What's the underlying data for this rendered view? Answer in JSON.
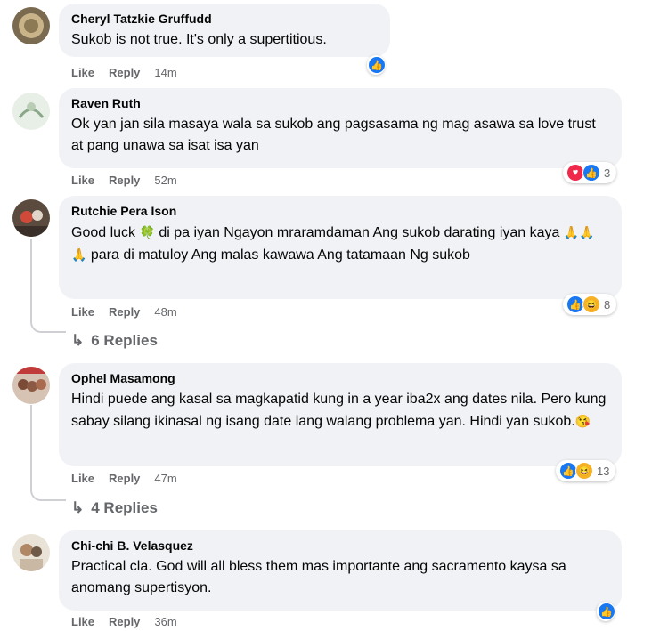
{
  "comments": [
    {
      "author": "Cheryl Tatzkie Gruffudd",
      "text": "Sukob is not true. It's only a supertitious.",
      "like": "Like",
      "reply": "Reply",
      "time": "14m",
      "reaction_count": ""
    },
    {
      "author": "Raven Ruth",
      "text": "Ok yan jan sila masaya wala sa sukob ang pagsasama ng mag asawa sa love trust at pang unawa sa isat isa yan",
      "like": "Like",
      "reply": "Reply",
      "time": "52m",
      "reaction_count": "3"
    },
    {
      "author": "Rutchie Pera Ison",
      "text_a": "Good luck ",
      "emoji_clover": "🍀",
      "text_b": " di pa iyan Ngayon mraramdaman Ang sukob darating iyan kaya ",
      "emoji_pray": "🙏🙏🙏",
      "text_c": " para di matuloy Ang malas kawawa Ang tatamaan Ng sukob",
      "like": "Like",
      "reply": "Reply",
      "time": "48m",
      "reaction_count": "8",
      "replies": "6 Replies"
    },
    {
      "author": "Ophel Masamong",
      "text": "Hindi puede ang kasal sa magkapatid kung in a year iba2x ang dates nila. Pero kung sabay silang ikinasal ng isang date lang walang problema yan. Hindi yan sukob.",
      "emoji_kiss": "😘",
      "like": "Like",
      "reply": "Reply",
      "time": "47m",
      "reaction_count": "13",
      "replies": "4 Replies"
    },
    {
      "author": "Chi-chi B. Velasquez",
      "text": "Practical cla. God will all bless them mas importante ang sacramento kaysa sa anomang supertisyon.",
      "like": "Like",
      "reply": "Reply",
      "time": "36m",
      "reaction_count": ""
    }
  ],
  "icons": {
    "like": "like-icon",
    "love": "love-icon",
    "haha": "haha-icon",
    "reply_arrow": "reply-arrow-icon"
  },
  "colors": {
    "like_blue": "#1877f2",
    "love_red": "#f02849",
    "haha_yellow": "#f7b125",
    "bubble_bg": "#f0f2f5",
    "meta_gray": "#65676b"
  }
}
